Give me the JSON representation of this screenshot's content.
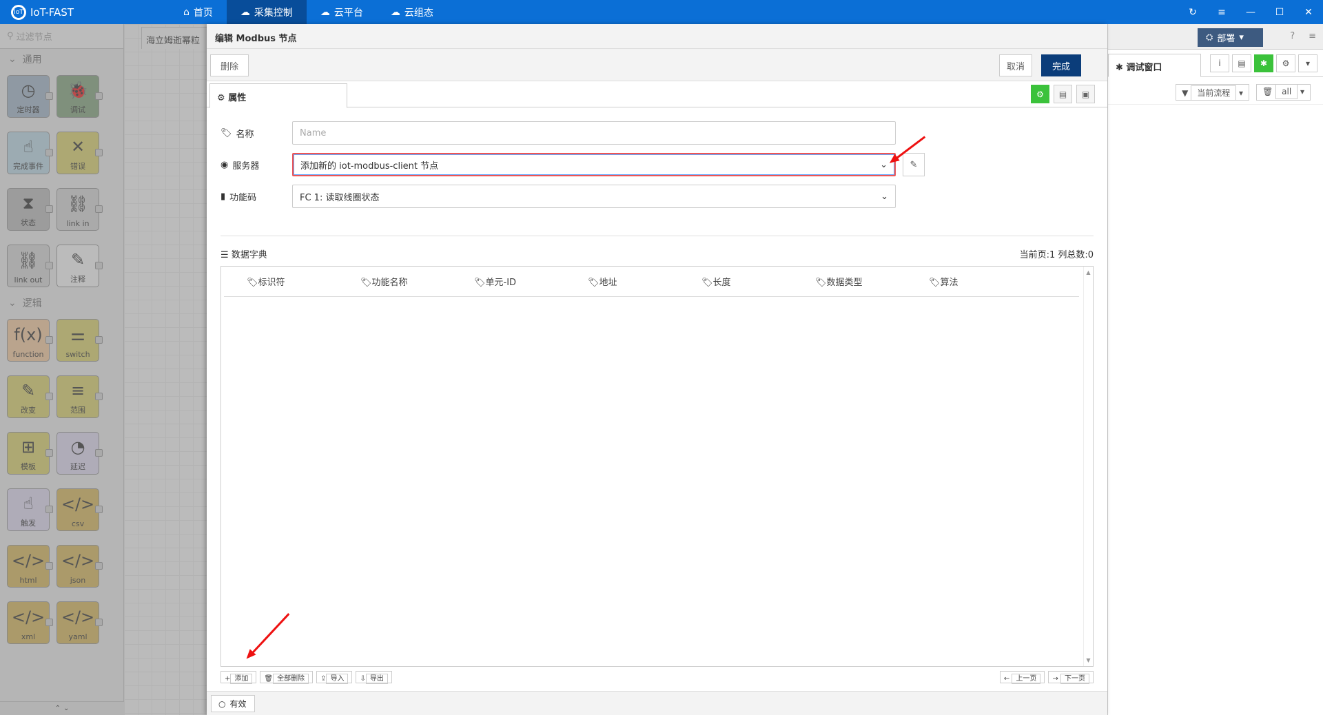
{
  "app": {
    "title": "IoT-FAST"
  },
  "nav": [
    {
      "label": "首页",
      "icon": "home-icon"
    },
    {
      "label": "采集控制",
      "icon": "cloud-icon"
    },
    {
      "label": "云平台",
      "icon": "cloud-platform-icon"
    },
    {
      "label": "云组态",
      "icon": "cloud-config-icon"
    }
  ],
  "palette": {
    "filter_placeholder": "过滤节点",
    "category_common": "通用",
    "category_logic": "逻辑",
    "nodes_common": [
      {
        "label": "定时器",
        "color": "#a6bbcf",
        "glyph": "◷"
      },
      {
        "label": "调试",
        "color": "#87a980",
        "glyph": "🐞"
      },
      {
        "label": "完成事件",
        "color": "#c0deed",
        "glyph": "☝"
      },
      {
        "label": "错误",
        "color": "#e2d96e",
        "glyph": "✕"
      },
      {
        "label": "状态",
        "color": "#c0c0c0",
        "glyph": "⧗"
      },
      {
        "label": "link in",
        "color": "#dddddd",
        "glyph": "⛓"
      },
      {
        "label": "link out",
        "color": "#dddddd",
        "glyph": "⛓"
      },
      {
        "label": "注释",
        "color": "#ffffff",
        "glyph": "✎"
      }
    ],
    "nodes_logic": [
      {
        "label": "function",
        "color": "#fdd0a2",
        "glyph": "f(x)"
      },
      {
        "label": "switch",
        "color": "#e2d96e",
        "glyph": "⚌"
      },
      {
        "label": "改变",
        "color": "#e2d96e",
        "glyph": "✎"
      },
      {
        "label": "范围",
        "color": "#e2d96e",
        "glyph": "≡"
      },
      {
        "label": "模板",
        "color": "#e2d96e",
        "glyph": "⊞"
      },
      {
        "label": "延迟",
        "color": "#e6e0f8",
        "glyph": "◔"
      },
      {
        "label": "触发",
        "color": "#e6e0f8",
        "glyph": "☝"
      },
      {
        "label": "csv",
        "color": "#debd5c",
        "glyph": "</>"
      },
      {
        "label": "html",
        "color": "#debd5c",
        "glyph": "</>"
      },
      {
        "label": "json",
        "color": "#debd5c",
        "glyph": "</>"
      },
      {
        "label": "xml",
        "color": "#debd5c",
        "glyph": "</>"
      },
      {
        "label": "yaml",
        "color": "#debd5c",
        "glyph": "</>"
      }
    ]
  },
  "workspace": {
    "tab_label": "海立姆逝幂粒"
  },
  "tray": {
    "title": "编辑 Modbus 节点",
    "delete_label": "删除",
    "cancel_label": "取消",
    "done_label": "完成",
    "tab_properties": "属性",
    "fields": {
      "name_label": "名称",
      "name_placeholder": "Name",
      "server_label": "服务器",
      "server_value": "添加新的 iot-modbus-client 节点",
      "fc_label": "功能码",
      "fc_value": "FC 1: 读取线圈状态"
    },
    "dict": {
      "title": "数据字典",
      "page_info": "当前页:1   列总数:0",
      "columns": [
        "标识符",
        "功能名称",
        "单元-ID",
        "地址",
        "长度",
        "数据类型",
        "算法"
      ],
      "add_label": "添加",
      "clear_label": "全部删除",
      "import_label": "导入",
      "export_label": "导出",
      "prev_label": "上一页",
      "next_label": "下一页"
    },
    "valid_label": "有效"
  },
  "sidebar": {
    "deploy_label": "部署",
    "debug_tab": "调试窗口",
    "filter_flow": "当前流程",
    "filter_all": "all"
  }
}
